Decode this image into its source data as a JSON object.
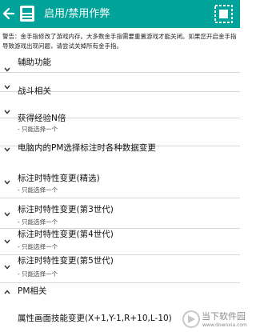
{
  "header": {
    "title": "启用/禁用作弊",
    "bg_color": "#00a39a",
    "back_icon": "arrow-left",
    "app_icon": "gameboy-cartridge",
    "menu_icon": "selection-grid"
  },
  "warning": "警告：金手指修改了游戏内存。大多数金手指需要重置游戏才能关闭。如果您开启金手指导致游戏出现问题，请尝试关掉所有金手指。",
  "items": [
    {
      "title": "辅助功能",
      "subtitle": "",
      "expanded": false
    },
    {
      "title": "战斗相关",
      "subtitle": "",
      "expanded": false
    },
    {
      "title": "获得经验N倍",
      "subtitle": "- 只能选择一个",
      "expanded": false
    },
    {
      "title": "电脑内的PM选择标注时各种数据变更",
      "subtitle": "",
      "expanded": false
    },
    {
      "title": "标注时特性变更(精选)",
      "subtitle": "- 只能选择一个",
      "expanded": false
    },
    {
      "title": "标注时特性变更(第3世代)",
      "subtitle": "- 只能选择一个",
      "expanded": false
    },
    {
      "title": "标注时特性变更(第4世代)",
      "subtitle": "- 只能选择一个",
      "expanded": false
    },
    {
      "title": "标注时特性变更(第5世代)",
      "subtitle": "- 只能选择一个",
      "expanded": false
    },
    {
      "title": "PM相关",
      "subtitle": "",
      "expanded": true
    },
    {
      "title": "属性画面技能变更(X+1,Y-1,R+10,L-10)",
      "subtitle": "",
      "expanded": false
    }
  ],
  "watermark": {
    "text": "当下软件园",
    "url": "www.downxia.com"
  }
}
